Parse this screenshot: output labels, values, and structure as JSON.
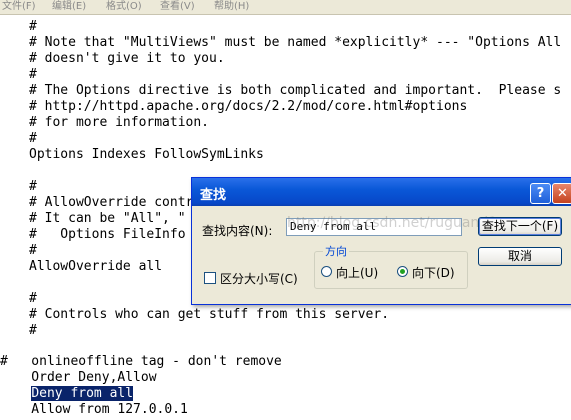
{
  "menu": [
    "文件(F)",
    "编辑(E)",
    "格式(O)",
    "查看(V)",
    "帮助(H)"
  ],
  "editor_lines": [
    "#",
    "# Note that \"MultiViews\" must be named *explicitly* --- \"Options All",
    "# doesn't give it to you.",
    "#",
    "# The Options directive is both complicated and important.  Please s",
    "# http://httpd.apache.org/docs/2.2/mod/core.html#options",
    "# for more information.",
    "#",
    "Options Indexes FollowSymLinks",
    "",
    "#",
    "# AllowOverride contr",
    "# It can be \"All\", \"",
    "#   Options FileInfo",
    "#",
    "AllowOverride all",
    "",
    "#",
    "# Controls who can get stuff from this server.",
    "#",
    "",
    "#   onlineoffline tag - don't remove",
    "    Order Deny,Allow",
    "    Deny from all",
    "    Allow from 127.0.0.1"
  ],
  "selected_text": "Deny from all",
  "dialog": {
    "title": "查找",
    "help_glyph": "?",
    "close_glyph": "✕",
    "find_label": "查找内容(N):",
    "find_value": "Deny from all",
    "watermark": "http://blog.csdn.net/ruguand1",
    "find_next_label": "查找下一个(F)",
    "cancel_label": "取消",
    "match_case_label": "区分大小写(C)",
    "match_case_checked": false,
    "direction_legend": "方向",
    "direction_up_label": "向上(U)",
    "direction_down_label": "向下(D)",
    "direction_selected": "down"
  }
}
